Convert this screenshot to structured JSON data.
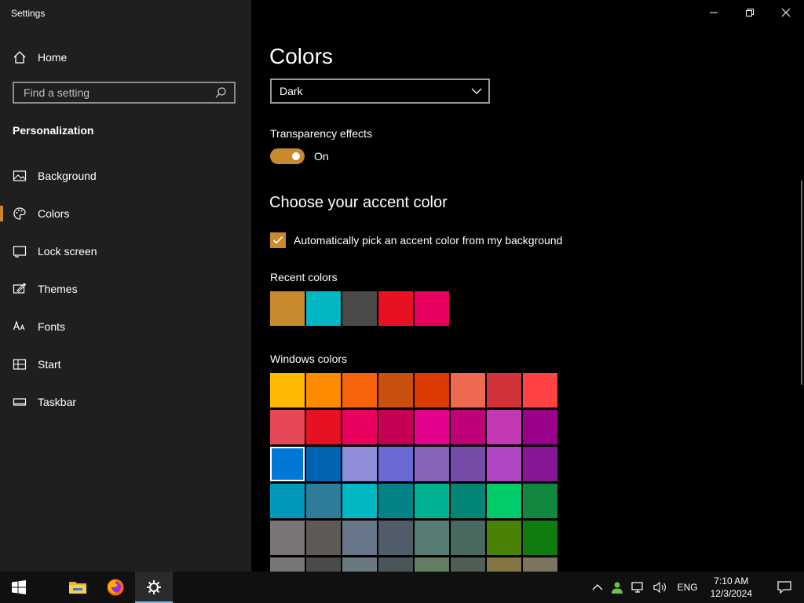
{
  "window": {
    "title": "Settings"
  },
  "sidebar": {
    "home_label": "Home",
    "search_placeholder": "Find a setting",
    "section_title": "Personalization",
    "items": [
      {
        "label": "Background",
        "icon": "picture-icon"
      },
      {
        "label": "Colors",
        "icon": "palette-icon",
        "active": true
      },
      {
        "label": "Lock screen",
        "icon": "lock-screen-icon"
      },
      {
        "label": "Themes",
        "icon": "themes-icon"
      },
      {
        "label": "Fonts",
        "icon": "fonts-icon"
      },
      {
        "label": "Start",
        "icon": "start-icon"
      },
      {
        "label": "Taskbar",
        "icon": "taskbar-icon"
      }
    ]
  },
  "main": {
    "title": "Colors",
    "mode_dropdown": {
      "selected": "Dark"
    },
    "transparency": {
      "label": "Transparency effects",
      "state": "On"
    },
    "accent_heading": "Choose your accent color",
    "auto_pick_label": "Automatically pick an accent color from my background",
    "recent_label": "Recent colors",
    "recent_colors": [
      "#c98a2d",
      "#00b7c3",
      "#4c4a48",
      "#e81123",
      "#ea005e"
    ],
    "windows_label": "Windows colors",
    "windows_colors": [
      "#ffb900",
      "#ff8c00",
      "#f7630c",
      "#ca5010",
      "#da3b01",
      "#ef6950",
      "#d13438",
      "#ff4343",
      "#e74856",
      "#e81123",
      "#ea005e",
      "#c30052",
      "#e3008c",
      "#bf0077",
      "#c239b3",
      "#9a0089",
      "#0078d7",
      "#0063b1",
      "#8e8cd8",
      "#6b69d6",
      "#8764b8",
      "#744da9",
      "#b146c2",
      "#881798",
      "#0099bc",
      "#2d7d9a",
      "#00b7c3",
      "#038387",
      "#00b294",
      "#018574",
      "#00cc6a",
      "#10893e",
      "#7a7574",
      "#5d5a58",
      "#68768a",
      "#515c6b",
      "#567c73",
      "#486860",
      "#498205",
      "#107c10",
      "#767676",
      "#4c4a48",
      "#69797e",
      "#4a5459",
      "#647c64",
      "#525e54",
      "#847545",
      "#7e735f"
    ],
    "selected_color": "#0078d7"
  },
  "accent": "#c98a2d",
  "taskbar": {
    "language": "ENG",
    "time": "7:10 AM",
    "date": "12/3/2024"
  }
}
